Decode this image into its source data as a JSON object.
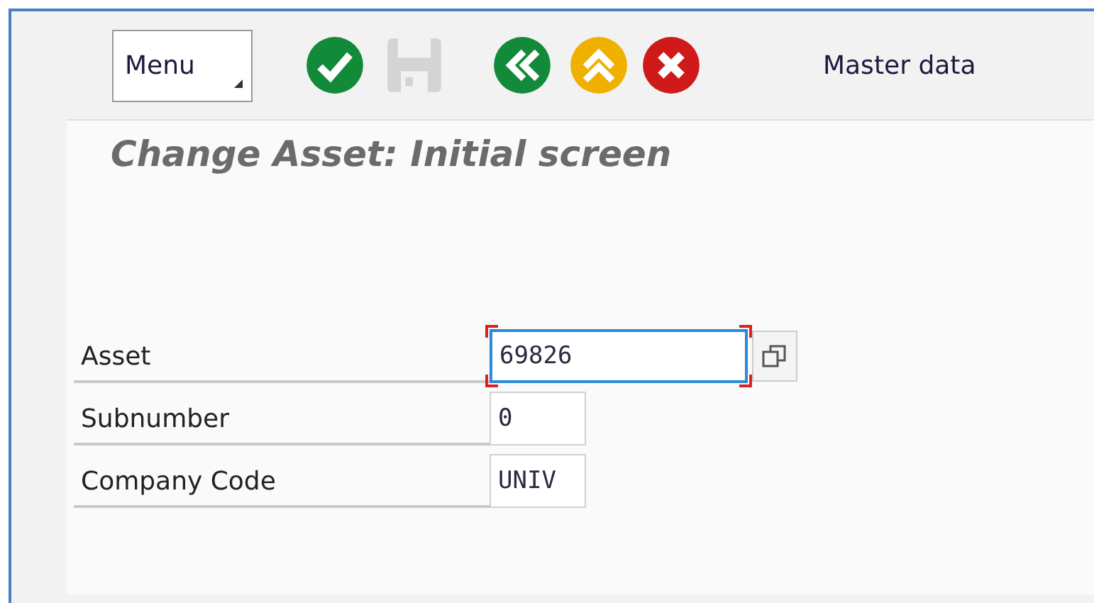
{
  "toolbar": {
    "menu": "Menu",
    "buttons": [
      {
        "kind": "check",
        "disabled": false
      },
      {
        "kind": "save",
        "disabled": true
      },
      {
        "kind": "back",
        "disabled": false
      },
      {
        "kind": "up",
        "disabled": false
      },
      {
        "kind": "cancel",
        "disabled": false
      }
    ],
    "link": "Master data"
  },
  "title": "Change Asset: Initial screen",
  "fields": [
    {
      "label": "Asset",
      "value": "69826",
      "focused": true,
      "wide": true
    },
    {
      "label": "Subnumber",
      "value": "0",
      "focused": false,
      "wide": false
    },
    {
      "label": "Company Code",
      "value": "UNIV",
      "focused": false,
      "wide": false
    }
  ]
}
